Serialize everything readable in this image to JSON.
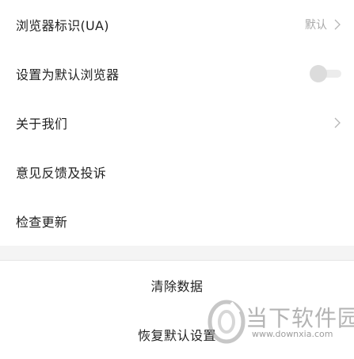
{
  "settings": {
    "items": [
      {
        "label": "浏览器标识(UA)",
        "value": "默认",
        "control": "chevron"
      },
      {
        "label": "设置为默认浏览器",
        "control": "toggle",
        "toggle_on": false
      },
      {
        "label": "关于我们",
        "control": "chevron"
      },
      {
        "label": "意见反馈及投诉",
        "control": "none"
      },
      {
        "label": "检查更新",
        "control": "none"
      }
    ]
  },
  "actions": {
    "clear_data": "清除数据",
    "restore_defaults": "恢复默认设置"
  },
  "watermark": {
    "title": "当下软件园",
    "url": "www.downxia.com",
    "logo_icon": "downxia-logo-icon"
  },
  "colors": {
    "text": "#222222",
    "secondary_text": "#a8a8a8",
    "divider_band": "#f4f4f4",
    "toggle_off": "#dcdcdc"
  }
}
